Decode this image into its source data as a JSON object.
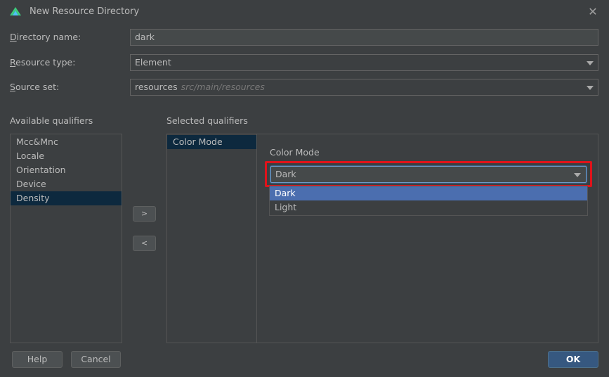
{
  "window": {
    "title": "New Resource Directory"
  },
  "form": {
    "directory_name": {
      "label_key": "D",
      "label_rest": "irectory name:",
      "value": "dark"
    },
    "resource_type": {
      "label_key": "R",
      "label_rest": "esource type:",
      "value": "Element"
    },
    "source_set": {
      "label_key": "S",
      "label_rest": "ource set:",
      "value": "resources",
      "hint": "src/main/resources"
    }
  },
  "available": {
    "heading": "Available qualifiers",
    "items": [
      "Mcc&Mnc",
      "Locale",
      "Orientation",
      "Device",
      "Density"
    ],
    "selected_index": 4
  },
  "transfer": {
    "add_label": ">",
    "remove_label": "<"
  },
  "selected": {
    "heading": "Selected qualifiers",
    "items": [
      "Color Mode"
    ],
    "detail_label": "Color Mode",
    "combo_value": "Dark",
    "options": [
      "Dark",
      "Light"
    ],
    "highlighted_option": "Dark"
  },
  "buttons": {
    "help": "Help",
    "cancel": "Cancel",
    "ok": "OK"
  },
  "colors": {
    "accent": "#4b6eaf",
    "selection": "#0d293e",
    "highlight_box": "#e0131b",
    "ok_button": "#365880"
  }
}
